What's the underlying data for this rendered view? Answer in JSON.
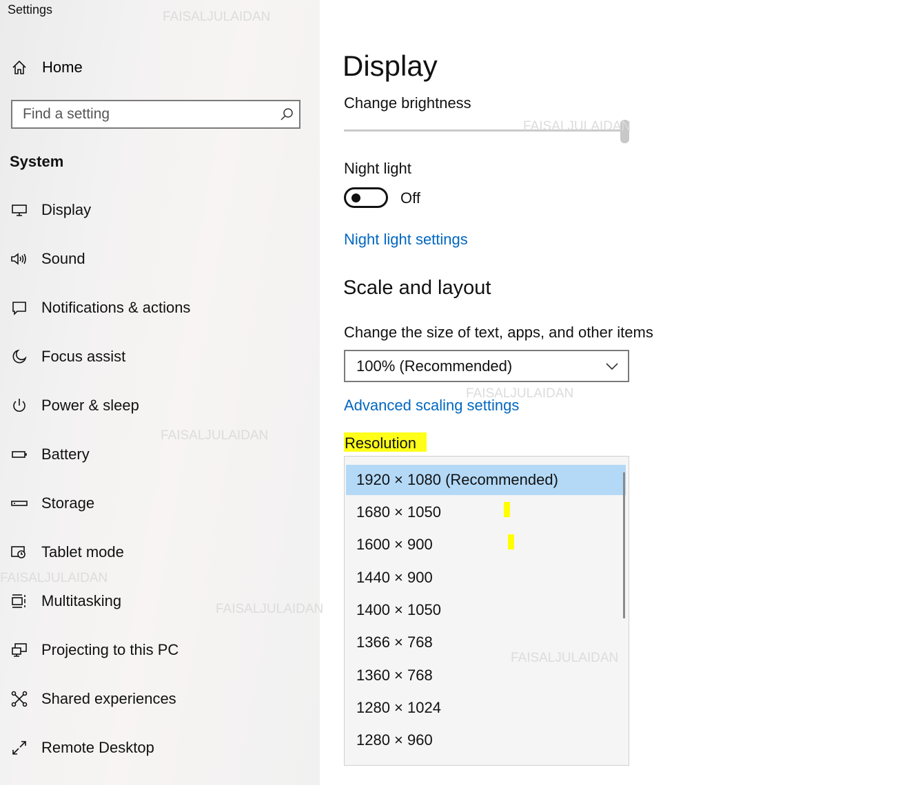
{
  "app": {
    "title": "Settings"
  },
  "sidebar": {
    "home_label": "Home",
    "search_placeholder": "Find a setting",
    "section": "System",
    "items": [
      {
        "label": "Display",
        "icon": "monitor-icon"
      },
      {
        "label": "Sound",
        "icon": "speaker-icon"
      },
      {
        "label": "Notifications & actions",
        "icon": "notification-icon"
      },
      {
        "label": "Focus assist",
        "icon": "moon-icon"
      },
      {
        "label": "Power & sleep",
        "icon": "power-icon"
      },
      {
        "label": "Battery",
        "icon": "battery-icon"
      },
      {
        "label": "Storage",
        "icon": "storage-icon"
      },
      {
        "label": "Tablet mode",
        "icon": "tablet-icon"
      },
      {
        "label": "Multitasking",
        "icon": "multitasking-icon"
      },
      {
        "label": "Projecting to this PC",
        "icon": "projector-icon"
      },
      {
        "label": "Shared experiences",
        "icon": "share-icon"
      },
      {
        "label": "Remote Desktop",
        "icon": "remote-desktop-icon"
      }
    ]
  },
  "main": {
    "title": "Display",
    "brightness_label": "Change brightness",
    "brightness_level": 1.0,
    "night_light": {
      "label": "Night light",
      "state": "Off",
      "settings_link": "Night light settings"
    },
    "scale": {
      "heading": "Scale and layout",
      "size_label": "Change the size of text, apps, and other items",
      "size_value": "100% (Recommended)",
      "advanced_link": "Advanced scaling settings"
    },
    "resolution": {
      "label": "Resolution",
      "selected": "1920 × 1080 (Recommended)",
      "options": [
        "1920 × 1080 (Recommended)",
        "1680 × 1050",
        "1600 × 900",
        "1440 × 900",
        "1400 × 1050",
        "1366 × 768",
        "1360 × 768",
        "1280 × 1024",
        "1280 × 960"
      ]
    }
  },
  "watermark": "FAISALJULAIDAN",
  "colors": {
    "link": "#0067c0",
    "selection": "#b3d9f7",
    "highlight": "#ffff1a"
  }
}
